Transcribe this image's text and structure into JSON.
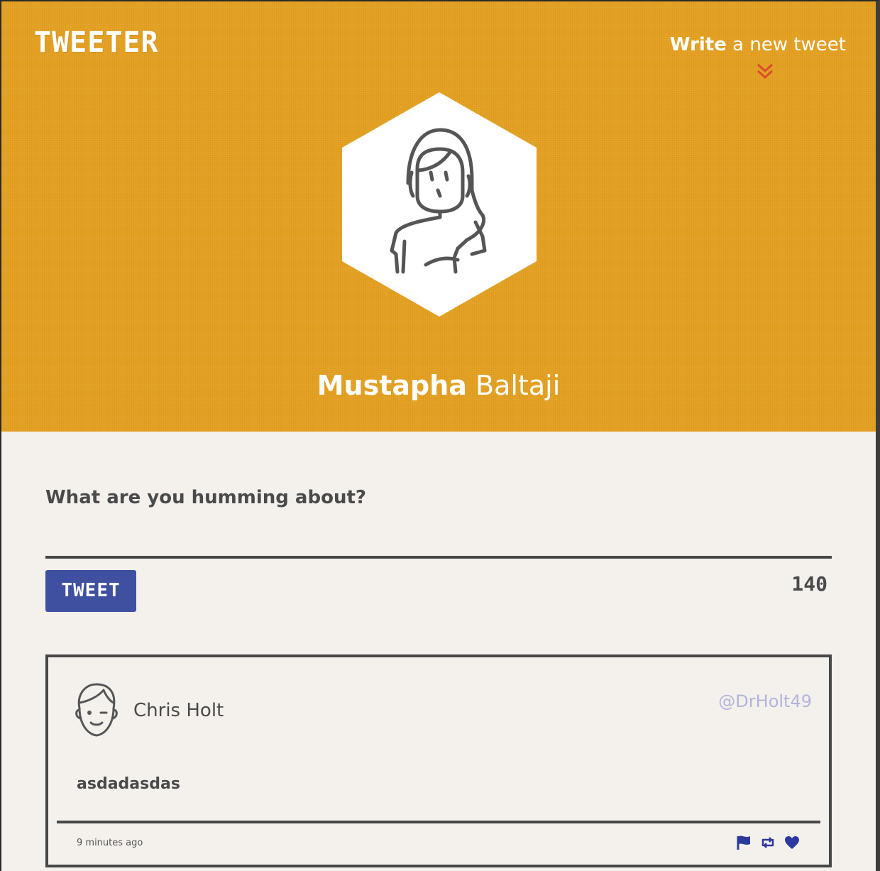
{
  "header": {
    "logo": "TWEETER",
    "compose_link": {
      "strong": "Write",
      "rest": " a new tweet"
    },
    "user": {
      "first_name": "Mustapha",
      "last_name": "Baltaji"
    }
  },
  "composer": {
    "label": "What are you humming about?",
    "input_value": "",
    "button_label": "TWEET",
    "char_counter": "140"
  },
  "tweets": [
    {
      "author": "Chris Holt",
      "handle": "@DrHolt49",
      "body": "asdadasdas",
      "timestamp": "9 minutes ago",
      "actions": [
        "flag-icon",
        "retweet-icon",
        "heart-icon"
      ]
    }
  ],
  "colors": {
    "header_bg": "#e3a021",
    "page_bg": "#f4f1ed",
    "accent": "#4050a0",
    "chevron": "#d94d2a",
    "handle": "#b3b3dd",
    "text": "#4a4a4a"
  }
}
